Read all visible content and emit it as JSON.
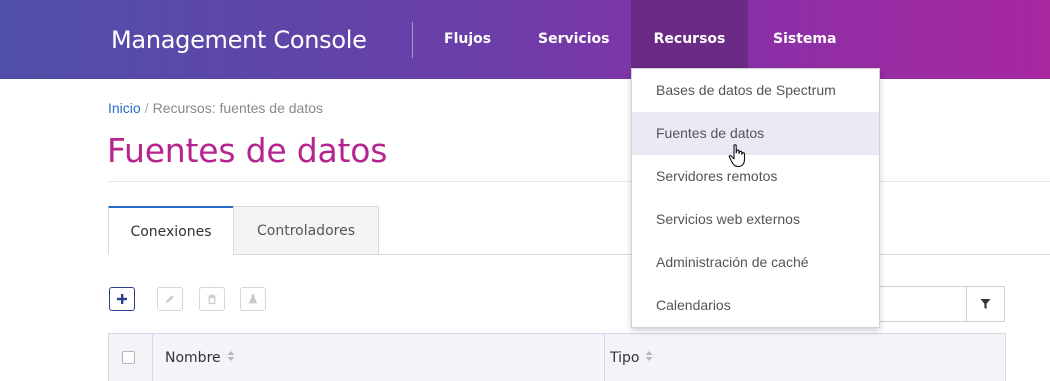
{
  "header": {
    "brand": "Management Console",
    "nav": [
      {
        "label": "Flujos"
      },
      {
        "label": "Servicios"
      },
      {
        "label": "Recursos",
        "active": true
      },
      {
        "label": "Sistema"
      }
    ]
  },
  "breadcrumb": {
    "home": "Inicio",
    "separator": "/",
    "current": "Recursos: fuentes de datos"
  },
  "page": {
    "title": "Fuentes de datos"
  },
  "tabs": [
    {
      "label": "Conexiones",
      "active": true
    },
    {
      "label": "Controladores",
      "active": false
    }
  ],
  "toolbar": {
    "add": "add-icon",
    "edit": "pencil-icon",
    "delete": "trash-icon",
    "test": "flask-icon"
  },
  "filter": {
    "value": "",
    "icon": "filter-icon"
  },
  "table": {
    "columns": [
      "Nombre",
      "Tipo"
    ],
    "sort_icon": "sort-icon"
  },
  "dropdown": {
    "items": [
      {
        "label": "Bases de datos de Spectrum"
      },
      {
        "label": "Fuentes de datos",
        "hover": true
      },
      {
        "label": "Servidores remotos"
      },
      {
        "label": "Servicios web externos"
      },
      {
        "label": "Administración de caché"
      },
      {
        "label": "Calendarios"
      }
    ]
  },
  "colors": {
    "header_start": "#4f4fa8",
    "header_end": "#a8289f",
    "nav_active": "#6b2a86",
    "title": "#b5248f",
    "link": "#2b6cc4",
    "menu_hover": "#e9eaf6"
  }
}
